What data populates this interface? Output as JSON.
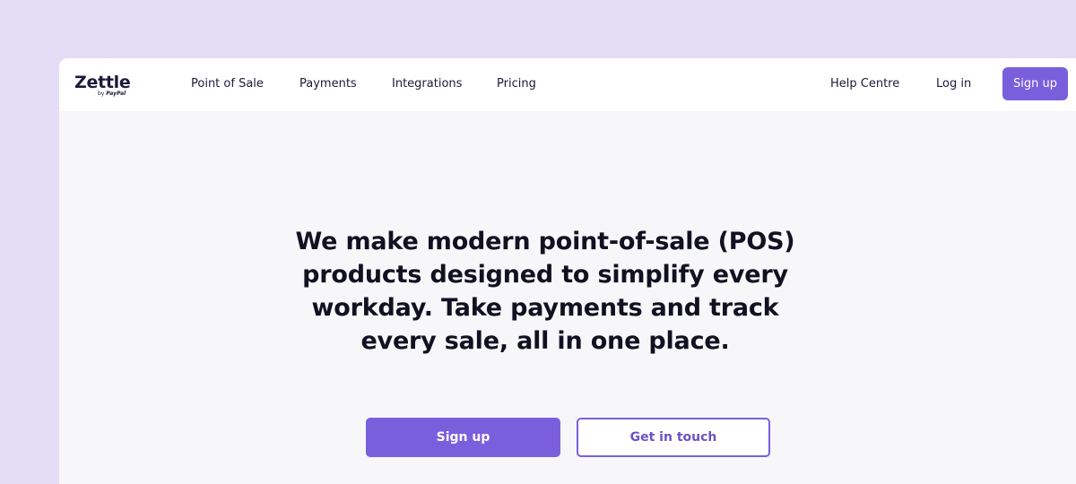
{
  "brand": {
    "name": "Zettle",
    "by": "by",
    "parent": "PayPal"
  },
  "nav": {
    "links": [
      "Point of Sale",
      "Payments",
      "Integrations",
      "Pricing"
    ],
    "help": "Help Centre",
    "login": "Log in",
    "signup": "Sign up"
  },
  "hero": {
    "headline": "We make modern point-of-sale (POS) products designed to simplify every workday. Take payments and track every sale, all in one place.",
    "primary_cta": "Sign up",
    "secondary_cta": "Get in touch"
  },
  "colors": {
    "accent": "#7a5fdd",
    "backdrop": "#e3def6",
    "page": "#f7f7f9"
  }
}
